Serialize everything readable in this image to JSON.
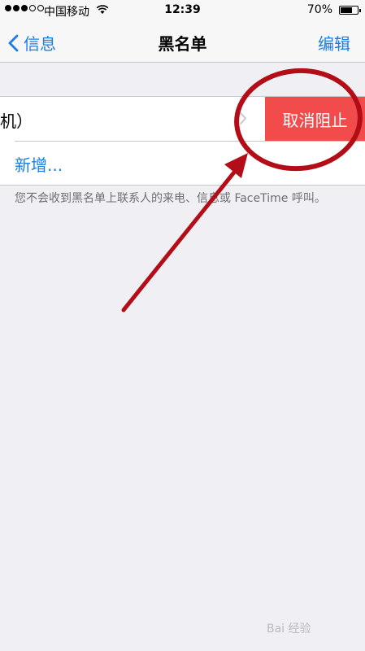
{
  "status_bar": {
    "carrier": "中国移动",
    "time": "12:39",
    "battery_percent": "70%",
    "battery_level": 0.7,
    "signal_bars": 3,
    "signal_total": 5
  },
  "nav": {
    "back_label": "信息",
    "title": "黑名单",
    "edit_label": "编辑"
  },
  "blocked_list": {
    "row1_label": "机）",
    "unblock_label": "取消阻止",
    "add_new_label": "新增..."
  },
  "footnote": "您不会收到黑名单上联系人的来电、信息或 FaceTime 呼叫。",
  "annotation": {
    "color": "#b30d17"
  },
  "watermark": "Bai 经验"
}
